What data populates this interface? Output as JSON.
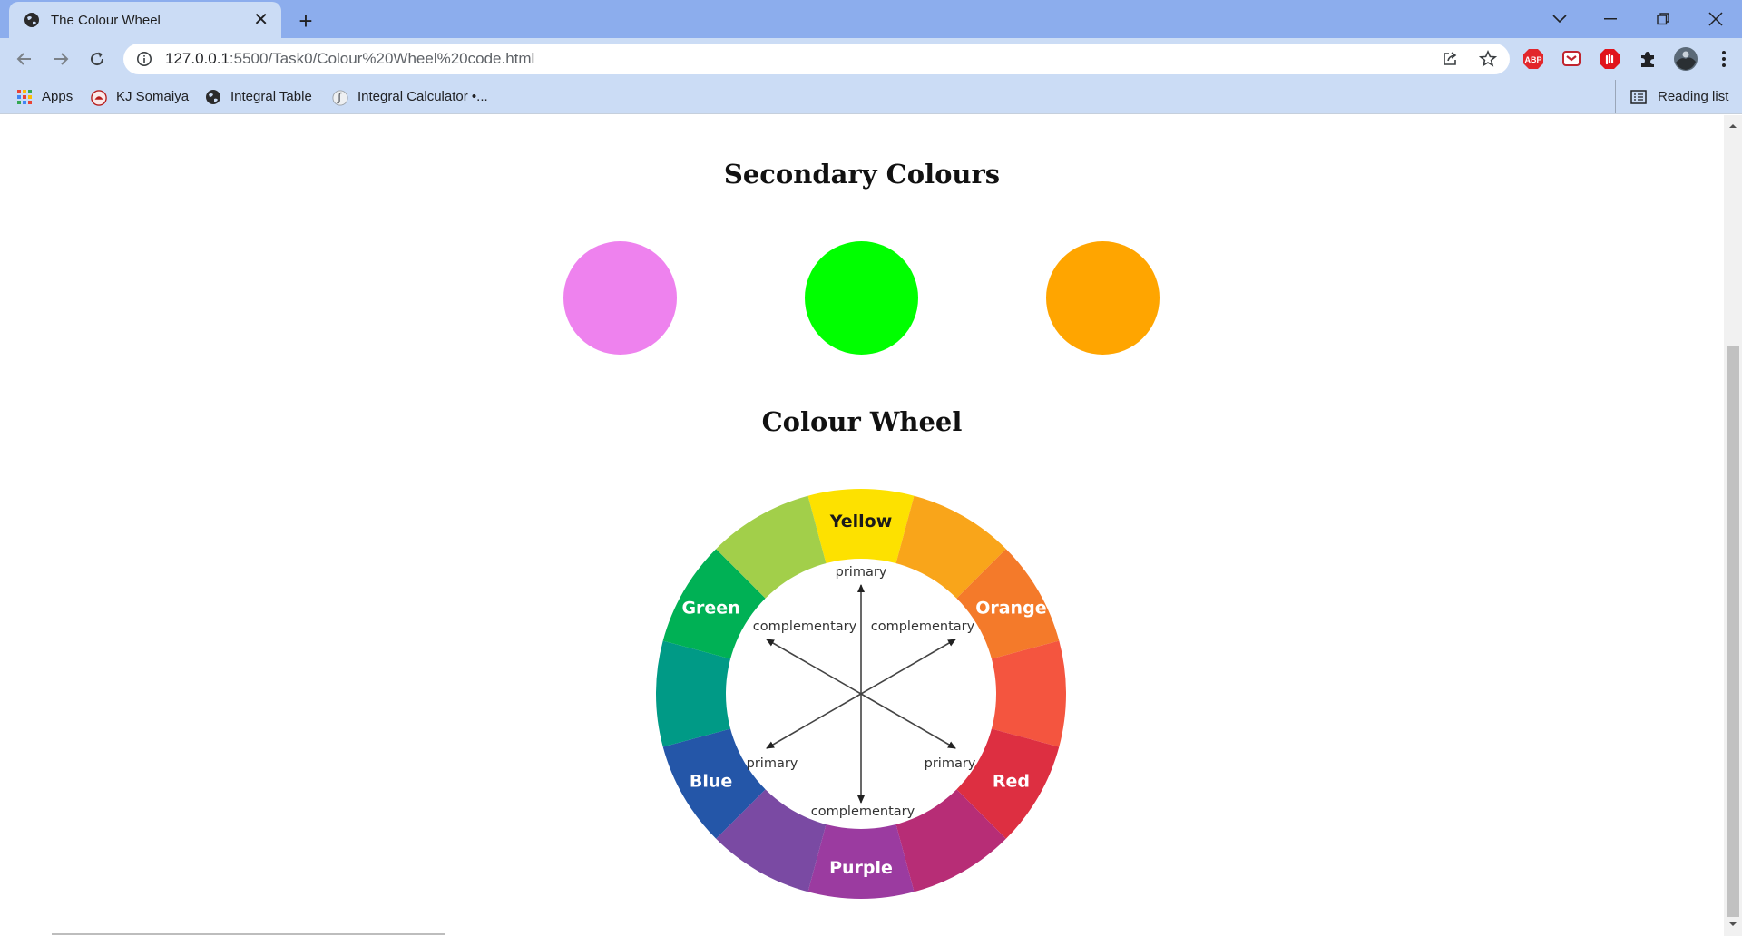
{
  "browser": {
    "tab_title": "The Colour Wheel",
    "url_host": "127.0.0.1",
    "url_path": ":5500/Task0/Colour%20Wheel%20code.html",
    "bookmarks": [
      "Apps",
      "KJ Somaiya",
      "Integral Table",
      "Integral Calculator •..."
    ],
    "reading_list": "Reading list",
    "extensions": [
      "ABP"
    ]
  },
  "page": {
    "secondary_heading": "Secondary Colours",
    "secondary_colors": [
      "#ee82ee",
      "#00ff00",
      "#ffa500"
    ],
    "wheel_heading": "Colour Wheel"
  },
  "wheel": {
    "segments": [
      {
        "label": "Yellow",
        "color": "#fde100"
      },
      {
        "label": "",
        "color": "#f9a51a"
      },
      {
        "label": "Orange",
        "color": "#f47a2a"
      },
      {
        "label": "",
        "color": "#f4553f"
      },
      {
        "label": "Red",
        "color": "#dd2f41"
      },
      {
        "label": "",
        "color": "#b72d76"
      },
      {
        "label": "Purple",
        "color": "#9b3ba0"
      },
      {
        "label": "",
        "color": "#7a4aa3"
      },
      {
        "label": "Blue",
        "color": "#2456a8"
      },
      {
        "label": "",
        "color": "#009a86"
      },
      {
        "label": "Green",
        "color": "#00b155"
      },
      {
        "label": "",
        "color": "#a2cf4a"
      }
    ],
    "inner_labels": {
      "top": "primary",
      "upper_left": "complementary",
      "upper_right": "complementary",
      "lower_left": "primary",
      "lower_right": "primary",
      "bottom": "complementary"
    }
  }
}
